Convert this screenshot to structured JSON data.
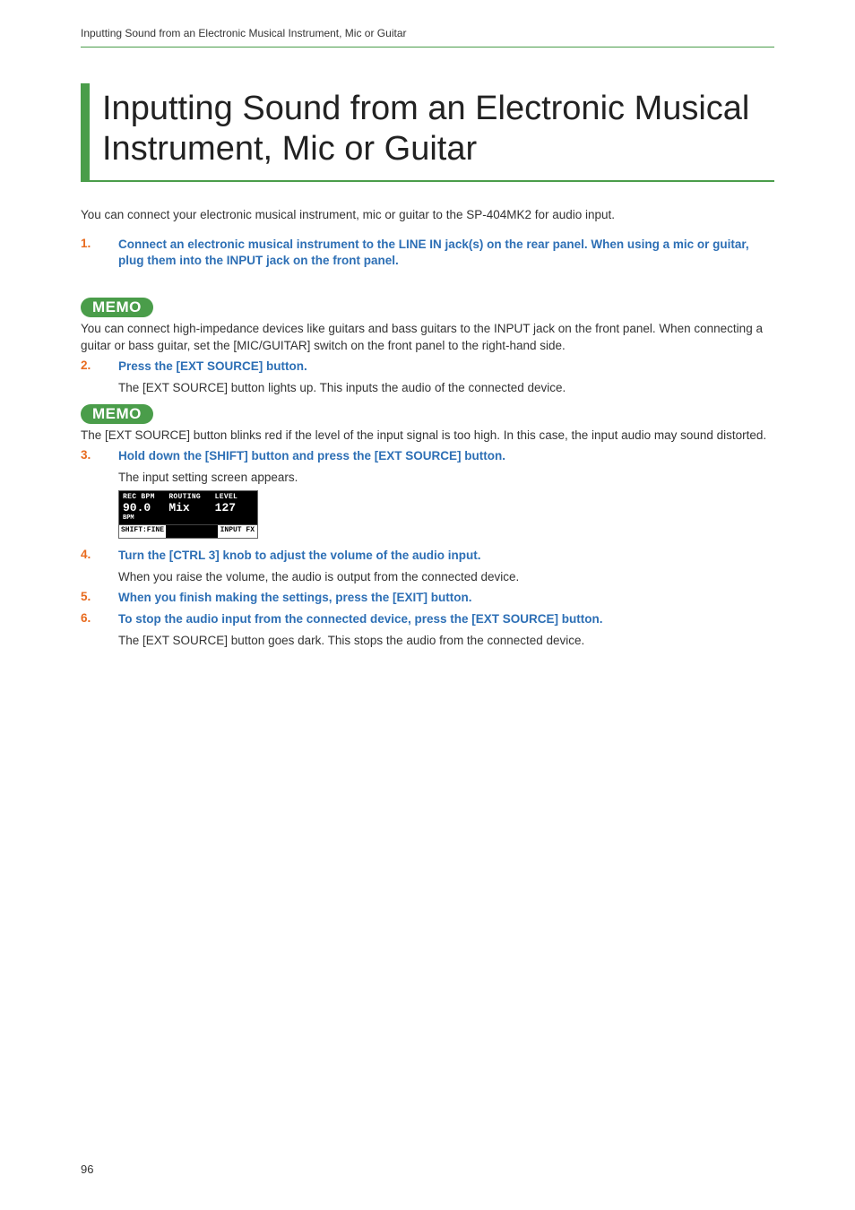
{
  "header": "Inputting Sound from an Electronic Musical Instrument, Mic or Guitar",
  "title": "Inputting Sound from an Electronic Musical Instrument, Mic or Guitar",
  "intro": "You can connect your electronic musical instrument, mic or guitar to the SP-404MK2 for audio input.",
  "memo_label": "MEMO",
  "steps": {
    "s1": {
      "num": "1.",
      "text": "Connect an electronic musical instrument to the LINE IN jack(s) on the rear panel. When using a mic or guitar, plug them into the INPUT jack on the front panel."
    },
    "memo1": "You can connect high-impedance devices like guitars and bass guitars to the INPUT jack on the front panel. When connecting a guitar or bass guitar, set the [MIC/GUITAR] switch on the front panel to the right-hand side.",
    "s2": {
      "num": "2.",
      "text": "Press the [EXT SOURCE] button.",
      "sub": "The [EXT SOURCE] button lights up. This inputs the audio of the connected device."
    },
    "memo2": "The [EXT SOURCE] button blinks red if the level of the input signal is too high. In this case, the input audio may sound distorted.",
    "s3": {
      "num": "3.",
      "text": "Hold down the [SHIFT] button and press the [EXT SOURCE] button.",
      "sub": "The input setting screen appears."
    },
    "s4": {
      "num": "4.",
      "text": "Turn the [CTRL 3] knob to adjust the volume of the audio input.",
      "sub": "When you raise the volume, the audio is output from the connected device."
    },
    "s5": {
      "num": "5.",
      "text": "When you finish making the settings, press the [EXIT] button."
    },
    "s6": {
      "num": "6.",
      "text": "To stop the audio input from the connected device, press the [EXT SOURCE] button.",
      "sub": "The [EXT SOURCE] button goes dark. This stops the audio from the connected device."
    }
  },
  "screen": {
    "h1": "REC BPM",
    "h2": "ROUTING",
    "h3": "LEVEL",
    "v1": "90.0",
    "v2": "Mix",
    "v3": "127",
    "u1": "BPM",
    "bl": "SHIFT:FINE",
    "br": "INPUT FX"
  },
  "page_number": "96"
}
